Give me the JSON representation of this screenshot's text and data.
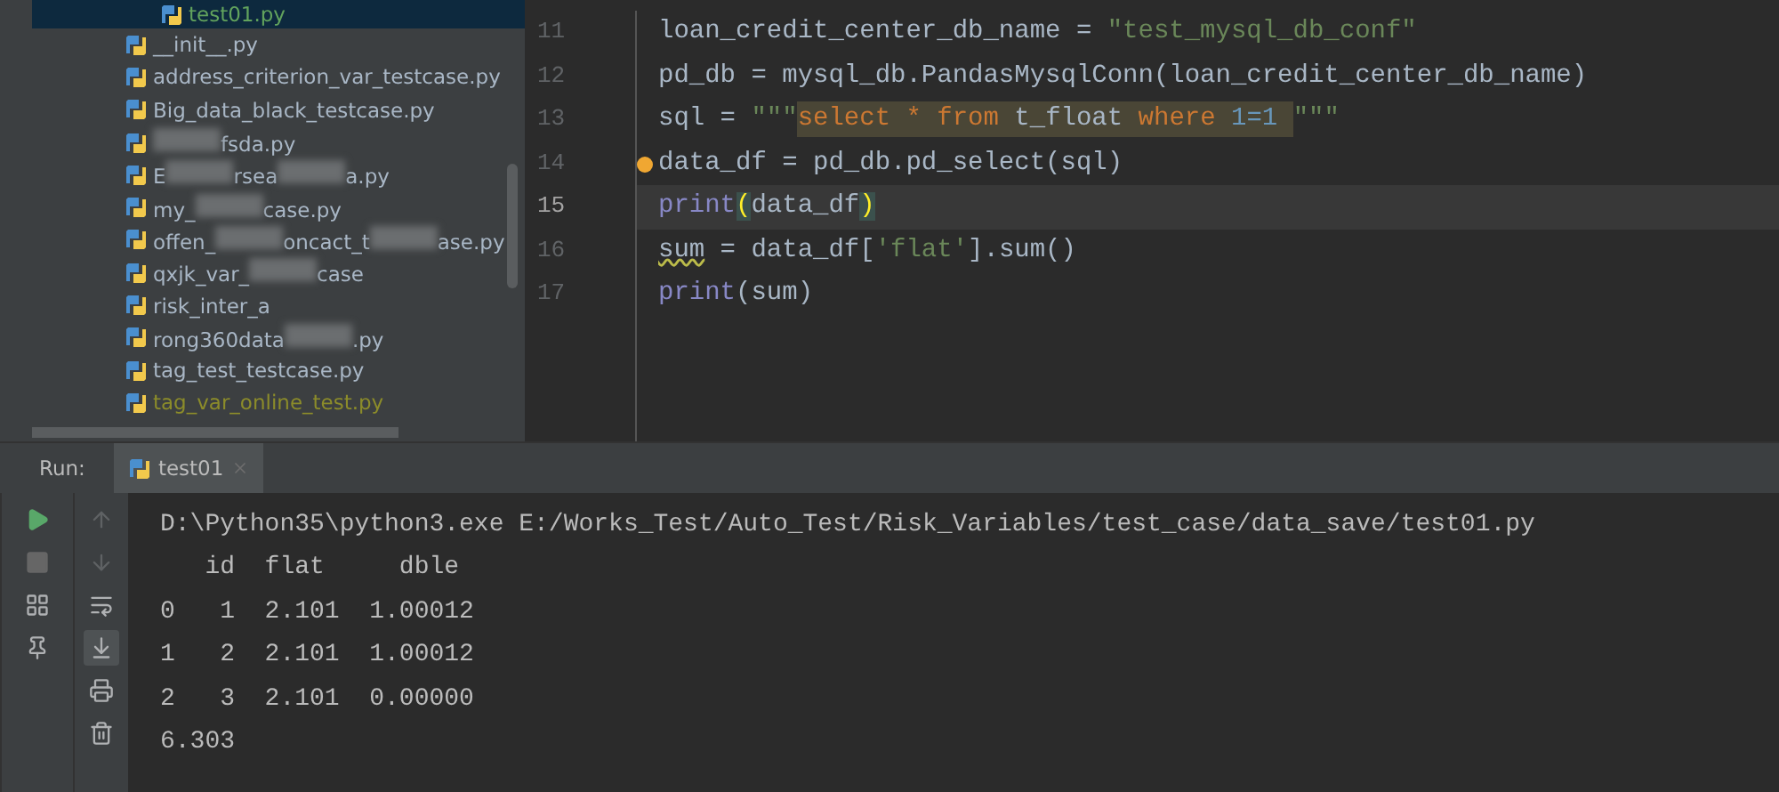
{
  "project_tree": {
    "items": [
      {
        "segments": [
          {
            "kind": "text",
            "text": "test01.py"
          }
        ],
        "color": "#62a35d",
        "selected": true
      },
      {
        "segments": [
          {
            "kind": "text",
            "text": "__init__.py"
          }
        ],
        "color": "#a9b7c6",
        "selected": false
      },
      {
        "segments": [
          {
            "kind": "text",
            "text": "address_criterion_var_testcase.py"
          }
        ],
        "color": "#a9b7c6",
        "selected": false
      },
      {
        "segments": [
          {
            "kind": "text",
            "text": "Big_data_black_testcase.py"
          }
        ],
        "color": "#a9b7c6",
        "selected": false
      },
      {
        "segments": [
          {
            "kind": "redacted"
          },
          {
            "kind": "text",
            "text": "fsda.py"
          }
        ],
        "color": "#a9b7c6",
        "selected": false
      },
      {
        "segments": [
          {
            "kind": "text",
            "text": "E"
          },
          {
            "kind": "redacted"
          },
          {
            "kind": "text",
            "text": "rsea"
          },
          {
            "kind": "redacted"
          },
          {
            "kind": "text",
            "text": "a.py"
          }
        ],
        "color": "#a9b7c6",
        "selected": false
      },
      {
        "segments": [
          {
            "kind": "text",
            "text": "my_"
          },
          {
            "kind": "redacted"
          },
          {
            "kind": "text",
            "text": "case.py"
          }
        ],
        "color": "#a9b7c6",
        "selected": false
      },
      {
        "segments": [
          {
            "kind": "text",
            "text": "offen_"
          },
          {
            "kind": "redacted"
          },
          {
            "kind": "text",
            "text": "oncact_t"
          },
          {
            "kind": "redacted"
          },
          {
            "kind": "text",
            "text": "ase.py"
          }
        ],
        "color": "#a9b7c6",
        "selected": false
      },
      {
        "segments": [
          {
            "kind": "text",
            "text": "qxjk_var_"
          },
          {
            "kind": "redacted"
          },
          {
            "kind": "text",
            "text": "case"
          }
        ],
        "color": "#a9b7c6",
        "selected": false
      },
      {
        "segments": [
          {
            "kind": "text",
            "text": "risk_inter_a"
          }
        ],
        "color": "#a9b7c6",
        "selected": false
      },
      {
        "segments": [
          {
            "kind": "text",
            "text": "rong360data"
          },
          {
            "kind": "redacted"
          },
          {
            "kind": "text",
            "text": ".py"
          }
        ],
        "color": "#a9b7c6",
        "selected": false
      },
      {
        "segments": [
          {
            "kind": "text",
            "text": "tag_test_testcase.py"
          }
        ],
        "color": "#a9b7c6",
        "selected": false
      },
      {
        "segments": [
          {
            "kind": "text",
            "text": "tag_var_online_test.py"
          }
        ],
        "color": "#8c8c2a",
        "selected": false
      }
    ]
  },
  "editor": {
    "lines": [
      {
        "number": "11",
        "current": false,
        "bulb": false,
        "tokens": [
          {
            "kind": "plain",
            "text": "loan_credit_center_db_name = "
          },
          {
            "kind": "string",
            "text": "\"test_mysql_db_conf\""
          }
        ]
      },
      {
        "number": "12",
        "current": false,
        "bulb": false,
        "tokens": [
          {
            "kind": "plain",
            "text": "pd_db = mysql_db.PandasMysqlConn(loan_credit_center_db_name)"
          }
        ]
      },
      {
        "number": "13",
        "current": false,
        "bulb": false,
        "tokens": [
          {
            "kind": "plain",
            "text": "sql = "
          },
          {
            "kind": "string",
            "text": "\"\"\""
          },
          {
            "kind": "sql_keyword",
            "text": "select "
          },
          {
            "kind": "sql_op",
            "text": "* "
          },
          {
            "kind": "sql_keyword",
            "text": "from "
          },
          {
            "kind": "sql_plain",
            "text": "t_float "
          },
          {
            "kind": "sql_keyword",
            "text": "where "
          },
          {
            "kind": "sql_number",
            "text": "1=1 "
          },
          {
            "kind": "string",
            "text": "\"\"\""
          }
        ]
      },
      {
        "number": "14",
        "current": false,
        "bulb": true,
        "tokens": [
          {
            "kind": "plain",
            "text": "data_df = pd_db.pd_select(sql)"
          }
        ]
      },
      {
        "number": "15",
        "current": true,
        "bulb": false,
        "tokens": [
          {
            "kind": "builtin",
            "text": "print"
          },
          {
            "kind": "brace",
            "text": "("
          },
          {
            "kind": "plain",
            "text": "data_df"
          },
          {
            "kind": "brace",
            "text": ")"
          }
        ]
      },
      {
        "number": "16",
        "current": false,
        "bulb": false,
        "tokens": [
          {
            "kind": "warning",
            "text": "sum"
          },
          {
            "kind": "plain",
            "text": " = data_df["
          },
          {
            "kind": "string",
            "text": "'flat'"
          },
          {
            "kind": "plain",
            "text": "].sum()"
          }
        ]
      },
      {
        "number": "17",
        "current": false,
        "bulb": false,
        "tokens": [
          {
            "kind": "builtin",
            "text": "print"
          },
          {
            "kind": "plain",
            "text": "(sum)"
          }
        ]
      }
    ]
  },
  "run_panel": {
    "label": "Run:",
    "tabs": [
      {
        "title": "test01",
        "selected": true
      }
    ],
    "tools_left": [
      {
        "kind": "run"
      },
      {
        "kind": "stop"
      },
      {
        "kind": "layout"
      },
      {
        "kind": "pin"
      }
    ],
    "tools_right": [
      {
        "kind": "up",
        "selected": false
      },
      {
        "kind": "down",
        "selected": false
      },
      {
        "kind": "wrap",
        "selected": false
      },
      {
        "kind": "scroll_end",
        "selected": true
      },
      {
        "kind": "print",
        "selected": false
      },
      {
        "kind": "trash",
        "selected": false
      }
    ],
    "output": [
      "D:\\Python35\\python3.exe E:/Works_Test/Auto_Test/Risk_Variables/test_case/data_save/test01.py",
      "   id  flat     dble",
      "0   1  2.101  1.00012",
      "1   2  2.101  1.00012",
      "2   3  2.101  0.00000",
      "6.303"
    ]
  }
}
